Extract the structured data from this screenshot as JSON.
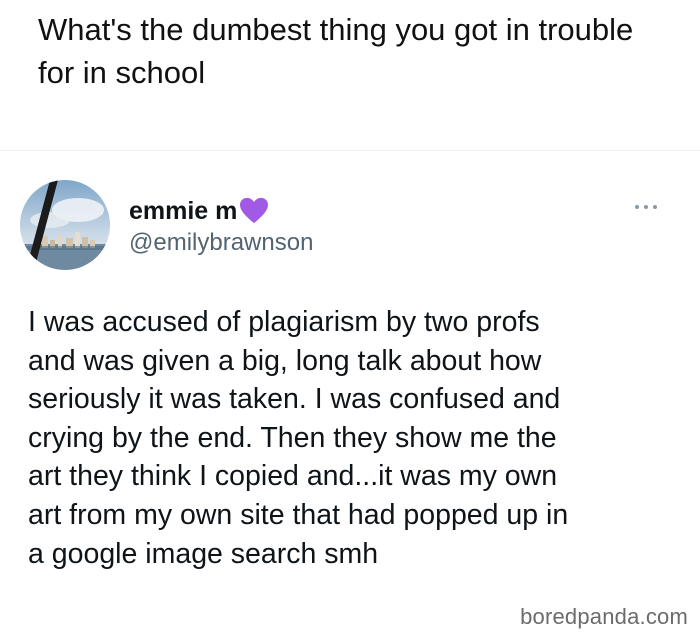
{
  "question": {
    "text": "What's the dumbest thing you got in trouble for in school"
  },
  "tweet": {
    "display_name": "emmie m",
    "handle": "@emilybrawnson",
    "name_emoji": "purple-heart-icon",
    "more_icon": "more-options-icon",
    "avatar_icon": "avatar-photo",
    "lines": [
      "I was accused of plagiarism by two profs",
      "and was given a big, long talk about how",
      "seriously it was taken. I was confused and",
      "crying by the end. Then they show me the",
      "art they think I copied and...it was my own",
      "art from my own site that had popped up in",
      "a google image search smh"
    ]
  },
  "watermark": {
    "text": "boredpanda.com"
  },
  "colors": {
    "name": "#0f1419",
    "handle": "#536471",
    "heart": "#a259e6",
    "background": "#ffffff"
  }
}
